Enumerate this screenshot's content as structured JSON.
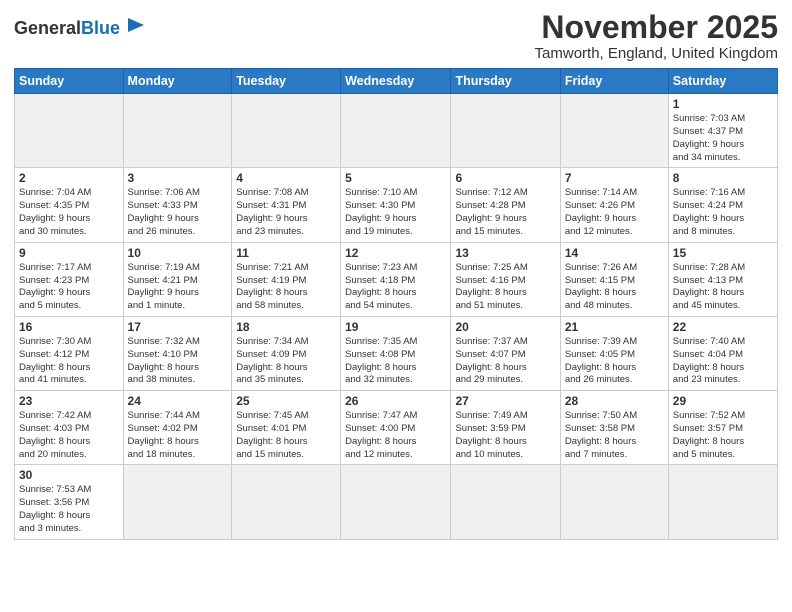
{
  "logo": {
    "text_general": "General",
    "text_blue": "Blue"
  },
  "title": "November 2025",
  "subtitle": "Tamworth, England, United Kingdom",
  "days_of_week": [
    "Sunday",
    "Monday",
    "Tuesday",
    "Wednesday",
    "Thursday",
    "Friday",
    "Saturday"
  ],
  "weeks": [
    [
      {
        "day": "",
        "empty": true
      },
      {
        "day": "",
        "empty": true
      },
      {
        "day": "",
        "empty": true
      },
      {
        "day": "",
        "empty": true
      },
      {
        "day": "",
        "empty": true
      },
      {
        "day": "",
        "empty": true
      },
      {
        "day": "1",
        "info": "Sunrise: 7:03 AM\nSunset: 4:37 PM\nDaylight: 9 hours\nand 34 minutes."
      }
    ],
    [
      {
        "day": "2",
        "info": "Sunrise: 7:04 AM\nSunset: 4:35 PM\nDaylight: 9 hours\nand 30 minutes."
      },
      {
        "day": "3",
        "info": "Sunrise: 7:06 AM\nSunset: 4:33 PM\nDaylight: 9 hours\nand 26 minutes."
      },
      {
        "day": "4",
        "info": "Sunrise: 7:08 AM\nSunset: 4:31 PM\nDaylight: 9 hours\nand 23 minutes."
      },
      {
        "day": "5",
        "info": "Sunrise: 7:10 AM\nSunset: 4:30 PM\nDaylight: 9 hours\nand 19 minutes."
      },
      {
        "day": "6",
        "info": "Sunrise: 7:12 AM\nSunset: 4:28 PM\nDaylight: 9 hours\nand 15 minutes."
      },
      {
        "day": "7",
        "info": "Sunrise: 7:14 AM\nSunset: 4:26 PM\nDaylight: 9 hours\nand 12 minutes."
      },
      {
        "day": "8",
        "info": "Sunrise: 7:16 AM\nSunset: 4:24 PM\nDaylight: 9 hours\nand 8 minutes."
      }
    ],
    [
      {
        "day": "9",
        "info": "Sunrise: 7:17 AM\nSunset: 4:23 PM\nDaylight: 9 hours\nand 5 minutes."
      },
      {
        "day": "10",
        "info": "Sunrise: 7:19 AM\nSunset: 4:21 PM\nDaylight: 9 hours\nand 1 minute."
      },
      {
        "day": "11",
        "info": "Sunrise: 7:21 AM\nSunset: 4:19 PM\nDaylight: 8 hours\nand 58 minutes."
      },
      {
        "day": "12",
        "info": "Sunrise: 7:23 AM\nSunset: 4:18 PM\nDaylight: 8 hours\nand 54 minutes."
      },
      {
        "day": "13",
        "info": "Sunrise: 7:25 AM\nSunset: 4:16 PM\nDaylight: 8 hours\nand 51 minutes."
      },
      {
        "day": "14",
        "info": "Sunrise: 7:26 AM\nSunset: 4:15 PM\nDaylight: 8 hours\nand 48 minutes."
      },
      {
        "day": "15",
        "info": "Sunrise: 7:28 AM\nSunset: 4:13 PM\nDaylight: 8 hours\nand 45 minutes."
      }
    ],
    [
      {
        "day": "16",
        "info": "Sunrise: 7:30 AM\nSunset: 4:12 PM\nDaylight: 8 hours\nand 41 minutes."
      },
      {
        "day": "17",
        "info": "Sunrise: 7:32 AM\nSunset: 4:10 PM\nDaylight: 8 hours\nand 38 minutes."
      },
      {
        "day": "18",
        "info": "Sunrise: 7:34 AM\nSunset: 4:09 PM\nDaylight: 8 hours\nand 35 minutes."
      },
      {
        "day": "19",
        "info": "Sunrise: 7:35 AM\nSunset: 4:08 PM\nDaylight: 8 hours\nand 32 minutes."
      },
      {
        "day": "20",
        "info": "Sunrise: 7:37 AM\nSunset: 4:07 PM\nDaylight: 8 hours\nand 29 minutes."
      },
      {
        "day": "21",
        "info": "Sunrise: 7:39 AM\nSunset: 4:05 PM\nDaylight: 8 hours\nand 26 minutes."
      },
      {
        "day": "22",
        "info": "Sunrise: 7:40 AM\nSunset: 4:04 PM\nDaylight: 8 hours\nand 23 minutes."
      }
    ],
    [
      {
        "day": "23",
        "info": "Sunrise: 7:42 AM\nSunset: 4:03 PM\nDaylight: 8 hours\nand 20 minutes."
      },
      {
        "day": "24",
        "info": "Sunrise: 7:44 AM\nSunset: 4:02 PM\nDaylight: 8 hours\nand 18 minutes."
      },
      {
        "day": "25",
        "info": "Sunrise: 7:45 AM\nSunset: 4:01 PM\nDaylight: 8 hours\nand 15 minutes."
      },
      {
        "day": "26",
        "info": "Sunrise: 7:47 AM\nSunset: 4:00 PM\nDaylight: 8 hours\nand 12 minutes."
      },
      {
        "day": "27",
        "info": "Sunrise: 7:49 AM\nSunset: 3:59 PM\nDaylight: 8 hours\nand 10 minutes."
      },
      {
        "day": "28",
        "info": "Sunrise: 7:50 AM\nSunset: 3:58 PM\nDaylight: 8 hours\nand 7 minutes."
      },
      {
        "day": "29",
        "info": "Sunrise: 7:52 AM\nSunset: 3:57 PM\nDaylight: 8 hours\nand 5 minutes."
      }
    ],
    [
      {
        "day": "30",
        "info": "Sunrise: 7:53 AM\nSunset: 3:56 PM\nDaylight: 8 hours\nand 3 minutes."
      },
      {
        "day": "",
        "empty": true
      },
      {
        "day": "",
        "empty": true
      },
      {
        "day": "",
        "empty": true
      },
      {
        "day": "",
        "empty": true
      },
      {
        "day": "",
        "empty": true
      },
      {
        "day": "",
        "empty": true
      }
    ]
  ]
}
